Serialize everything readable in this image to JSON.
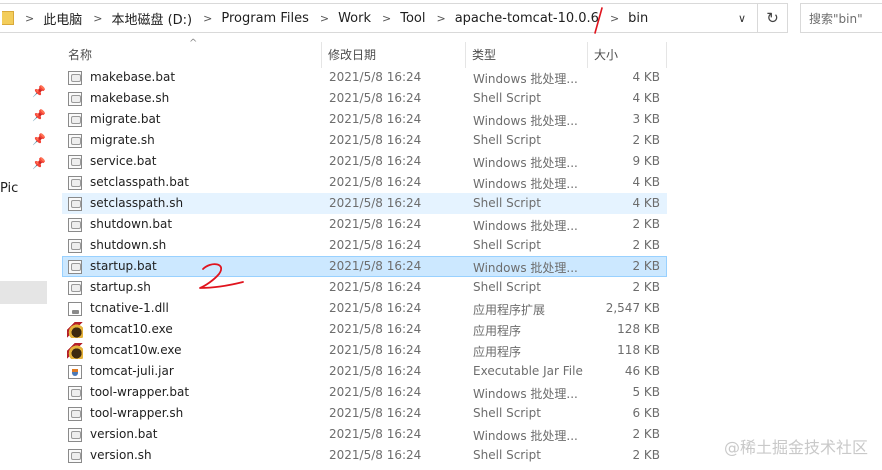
{
  "address_bar": {
    "breadcrumbs": [
      "此电脑",
      "本地磁盘 (D:)",
      "Program Files",
      "Work",
      "Tool",
      "apache-tomcat-10.0.6",
      "bin"
    ],
    "dropdown_glyph": "∨",
    "refresh_glyph": "↻",
    "search_placeholder": "搜索\"bin\""
  },
  "nav_pane": {
    "partial_label": "Pic",
    "pin_glyph": "📌"
  },
  "columns": {
    "name": "名称",
    "date": "修改日期",
    "type": "类型",
    "size": "大小"
  },
  "files": [
    {
      "name": "makebase.bat",
      "date": "2021/5/8 16:24",
      "type": "Windows 批处理...",
      "size": "4 KB",
      "icon": "script-icon"
    },
    {
      "name": "makebase.sh",
      "date": "2021/5/8 16:24",
      "type": "Shell Script",
      "size": "4 KB",
      "icon": "script-icon"
    },
    {
      "name": "migrate.bat",
      "date": "2021/5/8 16:24",
      "type": "Windows 批处理...",
      "size": "3 KB",
      "icon": "script-icon"
    },
    {
      "name": "migrate.sh",
      "date": "2021/5/8 16:24",
      "type": "Shell Script",
      "size": "2 KB",
      "icon": "script-icon"
    },
    {
      "name": "service.bat",
      "date": "2021/5/8 16:24",
      "type": "Windows 批处理...",
      "size": "9 KB",
      "icon": "script-icon"
    },
    {
      "name": "setclasspath.bat",
      "date": "2021/5/8 16:24",
      "type": "Windows 批处理...",
      "size": "4 KB",
      "icon": "script-icon"
    },
    {
      "name": "setclasspath.sh",
      "date": "2021/5/8 16:24",
      "type": "Shell Script",
      "size": "4 KB",
      "icon": "script-icon",
      "state": "hover"
    },
    {
      "name": "shutdown.bat",
      "date": "2021/5/8 16:24",
      "type": "Windows 批处理...",
      "size": "2 KB",
      "icon": "script-icon"
    },
    {
      "name": "shutdown.sh",
      "date": "2021/5/8 16:24",
      "type": "Shell Script",
      "size": "2 KB",
      "icon": "script-icon"
    },
    {
      "name": "startup.bat",
      "date": "2021/5/8 16:24",
      "type": "Windows 批处理...",
      "size": "2 KB",
      "icon": "script-icon",
      "state": "selected"
    },
    {
      "name": "startup.sh",
      "date": "2021/5/8 16:24",
      "type": "Shell Script",
      "size": "2 KB",
      "icon": "script-icon"
    },
    {
      "name": "tcnative-1.dll",
      "date": "2021/5/8 16:24",
      "type": "应用程序扩展",
      "size": "2,547 KB",
      "icon": "dll-icon"
    },
    {
      "name": "tomcat10.exe",
      "date": "2021/5/8 16:24",
      "type": "应用程序",
      "size": "128 KB",
      "icon": "tomcat-exe-icon"
    },
    {
      "name": "tomcat10w.exe",
      "date": "2021/5/8 16:24",
      "type": "应用程序",
      "size": "118 KB",
      "icon": "tomcat-exe-icon"
    },
    {
      "name": "tomcat-juli.jar",
      "date": "2021/5/8 16:24",
      "type": "Executable Jar File",
      "size": "46 KB",
      "icon": "jar-icon"
    },
    {
      "name": "tool-wrapper.bat",
      "date": "2021/5/8 16:24",
      "type": "Windows 批处理...",
      "size": "5 KB",
      "icon": "script-icon"
    },
    {
      "name": "tool-wrapper.sh",
      "date": "2021/5/8 16:24",
      "type": "Shell Script",
      "size": "6 KB",
      "icon": "script-icon"
    },
    {
      "name": "version.bat",
      "date": "2021/5/8 16:24",
      "type": "Windows 批处理...",
      "size": "2 KB",
      "icon": "script-icon"
    },
    {
      "name": "version.sh",
      "date": "2021/5/8 16:24",
      "type": "Shell Script",
      "size": "2 KB",
      "icon": "script-icon"
    }
  ],
  "annotations": {
    "mark_1": "1",
    "mark_2": "2",
    "color": "#e0141e"
  },
  "watermark": "@稀土掘金技术社区",
  "colors": {
    "selected_bg": "#cce8ff",
    "selected_border": "#99d1ff",
    "hover_bg": "#e5f3ff"
  }
}
